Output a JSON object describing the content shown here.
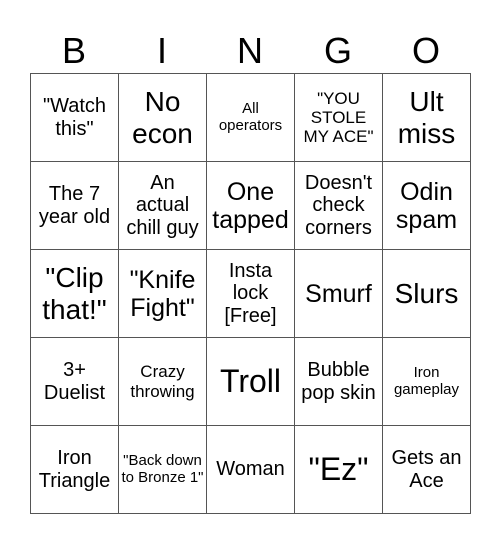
{
  "header": [
    "B",
    "I",
    "N",
    "G",
    "O"
  ],
  "cells": [
    [
      "\"Watch this\"",
      "No econ",
      "All operators",
      "\"YOU STOLE MY ACE\"",
      "Ult miss"
    ],
    [
      "The 7 year old",
      "An actual chill guy",
      "One tapped",
      "Doesn't check corners",
      "Odin spam"
    ],
    [
      "\"Clip that!\"",
      "\"Knife Fight\"",
      "Insta lock [Free]",
      "Smurf",
      "Slurs"
    ],
    [
      "3+ Duelist",
      "Crazy throwing",
      "Troll",
      "Bubble pop skin",
      "Iron gameplay"
    ],
    [
      "Iron Triangle",
      "\"Back down to Bronze 1\"",
      "Woman",
      "\"Ez\"",
      "Gets an Ace"
    ]
  ]
}
